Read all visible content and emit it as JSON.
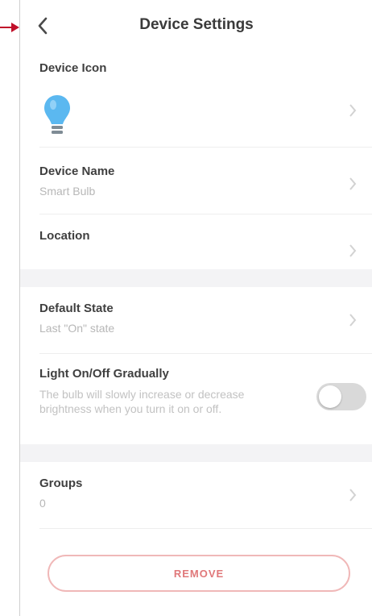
{
  "header": {
    "title": "Device Settings"
  },
  "device_icon": {
    "label": "Device Icon",
    "icon": "lightbulb-icon"
  },
  "device_name": {
    "label": "Device Name",
    "value": "Smart Bulb"
  },
  "location": {
    "label": "Location",
    "value": ""
  },
  "default_state": {
    "label": "Default State",
    "value": "Last \"On\" state"
  },
  "gradual": {
    "label": "Light On/Off Gradually",
    "description": "The bulb will slowly increase or decrease brightness when you turn it on or off.",
    "enabled": false
  },
  "groups": {
    "label": "Groups",
    "value": "0"
  },
  "actions": {
    "remove_label": "REMOVE"
  },
  "colors": {
    "accent_marker": "#c0102a",
    "bulb": "#5bb8f0",
    "remove": "#e0787a"
  }
}
